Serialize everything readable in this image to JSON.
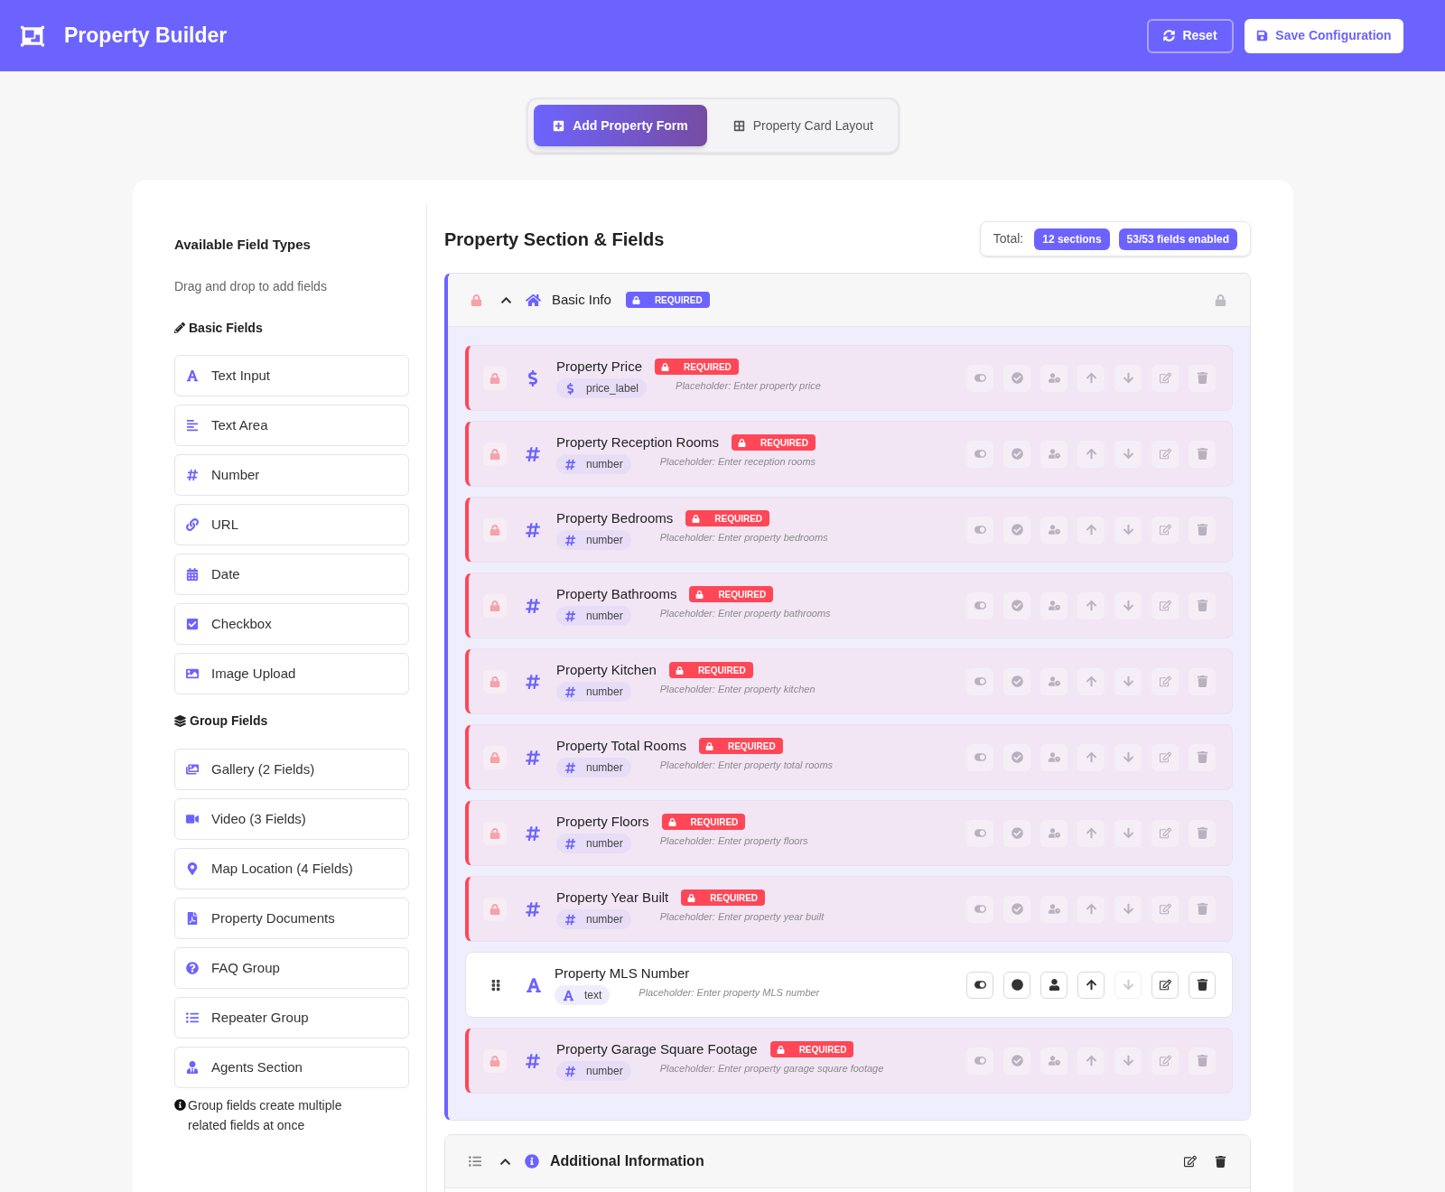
{
  "header": {
    "title": "Property Builder",
    "buttons": [
      {
        "label": "Reset",
        "kind": "reset"
      },
      {
        "label": "Save Configuration",
        "kind": "save"
      }
    ]
  },
  "tabs": [
    {
      "label": "Add Property Form",
      "selected": true
    },
    {
      "label": "Property Card Layout",
      "selected": false
    }
  ],
  "sidebar": {
    "title": "Available Field Types",
    "subtitle": "Drag and drop to add fields",
    "groups": [
      {
        "title": "Basic Fields",
        "kind": "basic",
        "items": [
          {
            "label": "Text Input",
            "kind": "text"
          },
          {
            "label": "Text Area",
            "kind": "textarea"
          },
          {
            "label": "Number",
            "kind": "number"
          },
          {
            "label": "URL",
            "kind": "url"
          },
          {
            "label": "Date",
            "kind": "date"
          },
          {
            "label": "Checkbox",
            "kind": "checkbox"
          },
          {
            "label": "Image Upload",
            "kind": "image"
          }
        ]
      },
      {
        "title": "Group Fields",
        "kind": "group",
        "items": [
          {
            "label": "Gallery (2 Fields)",
            "kind": "gallery"
          },
          {
            "label": "Video (3 Fields)",
            "kind": "video"
          },
          {
            "label": "Map Location (4 Fields)",
            "kind": "map"
          },
          {
            "label": "Property Documents",
            "kind": "documents"
          },
          {
            "label": "FAQ Group",
            "kind": "faq"
          },
          {
            "label": "Repeater Group",
            "kind": "repeater"
          },
          {
            "label": "Agents Section",
            "kind": "agents"
          }
        ]
      }
    ],
    "note": "Group fields create multiple related fields at once"
  },
  "builder": {
    "title": "Property Section & Fields",
    "total_label": "Total:",
    "totals": [
      "12 sections",
      "53/53 fields enabled"
    ],
    "sections": [
      {
        "title": "Basic Info",
        "selected": true,
        "expanded": true,
        "required": true,
        "badge": "REQUIRED",
        "fields": [
          {
            "title": "Property Price",
            "kind": "price",
            "type": "price_label",
            "hint": "Placeholder: Enter property price",
            "required": true,
            "badge": "REQUIRED",
            "actions": [
              {
                "kind": "toggle",
                "disabled": true
              },
              {
                "kind": "required",
                "disabled": true
              },
              {
                "kind": "agent",
                "disabled": true
              },
              {
                "kind": "up",
                "disabled": true
              },
              {
                "kind": "down",
                "disabled": true
              },
              {
                "kind": "edit",
                "disabled": true
              },
              {
                "kind": "delete",
                "disabled": true
              }
            ]
          },
          {
            "title": "Property Reception Rooms",
            "kind": "number",
            "type": "number",
            "hint": "Placeholder: Enter reception rooms",
            "required": true,
            "badge": "REQUIRED",
            "actions": [
              {
                "kind": "toggle",
                "disabled": true
              },
              {
                "kind": "required",
                "disabled": true
              },
              {
                "kind": "agent",
                "disabled": true
              },
              {
                "kind": "up",
                "disabled": true
              },
              {
                "kind": "down",
                "disabled": true
              },
              {
                "kind": "edit",
                "disabled": true
              },
              {
                "kind": "delete",
                "disabled": true
              }
            ]
          },
          {
            "title": "Property Bedrooms",
            "kind": "number",
            "type": "number",
            "hint": "Placeholder: Enter property bedrooms",
            "required": true,
            "badge": "REQUIRED",
            "actions": [
              {
                "kind": "toggle",
                "disabled": true
              },
              {
                "kind": "required",
                "disabled": true
              },
              {
                "kind": "agent",
                "disabled": true
              },
              {
                "kind": "up",
                "disabled": true
              },
              {
                "kind": "down",
                "disabled": true
              },
              {
                "kind": "edit",
                "disabled": true
              },
              {
                "kind": "delete",
                "disabled": true
              }
            ]
          },
          {
            "title": "Property Bathrooms",
            "kind": "number",
            "type": "number",
            "hint": "Placeholder: Enter property bathrooms",
            "required": true,
            "badge": "REQUIRED",
            "actions": [
              {
                "kind": "toggle",
                "disabled": true
              },
              {
                "kind": "required",
                "disabled": true
              },
              {
                "kind": "agent",
                "disabled": true
              },
              {
                "kind": "up",
                "disabled": true
              },
              {
                "kind": "down",
                "disabled": true
              },
              {
                "kind": "edit",
                "disabled": true
              },
              {
                "kind": "delete",
                "disabled": true
              }
            ]
          },
          {
            "title": "Property Kitchen",
            "kind": "number",
            "type": "number",
            "hint": "Placeholder: Enter property kitchen",
            "required": true,
            "badge": "REQUIRED",
            "actions": [
              {
                "kind": "toggle",
                "disabled": true
              },
              {
                "kind": "required",
                "disabled": true
              },
              {
                "kind": "agent",
                "disabled": true
              },
              {
                "kind": "up",
                "disabled": true
              },
              {
                "kind": "down",
                "disabled": true
              },
              {
                "kind": "edit",
                "disabled": true
              },
              {
                "kind": "delete",
                "disabled": true
              }
            ]
          },
          {
            "title": "Property Total Rooms",
            "kind": "number",
            "type": "number",
            "hint": "Placeholder: Enter property total rooms",
            "required": true,
            "badge": "REQUIRED",
            "actions": [
              {
                "kind": "toggle",
                "disabled": true
              },
              {
                "kind": "required",
                "disabled": true
              },
              {
                "kind": "agent",
                "disabled": true
              },
              {
                "kind": "up",
                "disabled": true
              },
              {
                "kind": "down",
                "disabled": true
              },
              {
                "kind": "edit",
                "disabled": true
              },
              {
                "kind": "delete",
                "disabled": true
              }
            ]
          },
          {
            "title": "Property Floors",
            "kind": "number",
            "type": "number",
            "hint": "Placeholder: Enter property floors",
            "required": true,
            "badge": "REQUIRED",
            "actions": [
              {
                "kind": "toggle",
                "disabled": true
              },
              {
                "kind": "required",
                "disabled": true
              },
              {
                "kind": "agent",
                "disabled": true
              },
              {
                "kind": "up",
                "disabled": true
              },
              {
                "kind": "down",
                "disabled": true
              },
              {
                "kind": "edit",
                "disabled": true
              },
              {
                "kind": "delete",
                "disabled": true
              }
            ]
          },
          {
            "title": "Property Year Built",
            "kind": "number",
            "type": "number",
            "hint": "Placeholder: Enter property year built",
            "required": true,
            "badge": "REQUIRED",
            "actions": [
              {
                "kind": "toggle",
                "disabled": true
              },
              {
                "kind": "required",
                "disabled": true
              },
              {
                "kind": "agent",
                "disabled": true
              },
              {
                "kind": "up",
                "disabled": true
              },
              {
                "kind": "down",
                "disabled": true
              },
              {
                "kind": "edit",
                "disabled": true
              },
              {
                "kind": "delete",
                "disabled": true
              }
            ]
          },
          {
            "title": "Property MLS Number",
            "kind": "text",
            "type": "text",
            "hint": "Placeholder: Enter property MLS number",
            "required": false,
            "actions": [
              {
                "kind": "toggle",
                "disabled": false
              },
              {
                "kind": "required",
                "disabled": false
              },
              {
                "kind": "agent",
                "disabled": false
              },
              {
                "kind": "up",
                "disabled": false
              },
              {
                "kind": "down",
                "disabled": true
              },
              {
                "kind": "edit",
                "disabled": false
              },
              {
                "kind": "delete",
                "disabled": false
              }
            ]
          },
          {
            "title": "Property Garage Square Footage",
            "kind": "number",
            "type": "number",
            "hint": "Placeholder: Enter property garage square footage",
            "required": true,
            "badge": "REQUIRED",
            "actions": [
              {
                "kind": "toggle",
                "disabled": true
              },
              {
                "kind": "required",
                "disabled": true
              },
              {
                "kind": "agent",
                "disabled": true
              },
              {
                "kind": "up",
                "disabled": true
              },
              {
                "kind": "down",
                "disabled": true
              },
              {
                "kind": "edit",
                "disabled": true
              },
              {
                "kind": "delete",
                "disabled": true
              }
            ]
          }
        ]
      },
      {
        "title": "Additional Information",
        "selected": false,
        "expanded": true,
        "required": false
      }
    ]
  }
}
